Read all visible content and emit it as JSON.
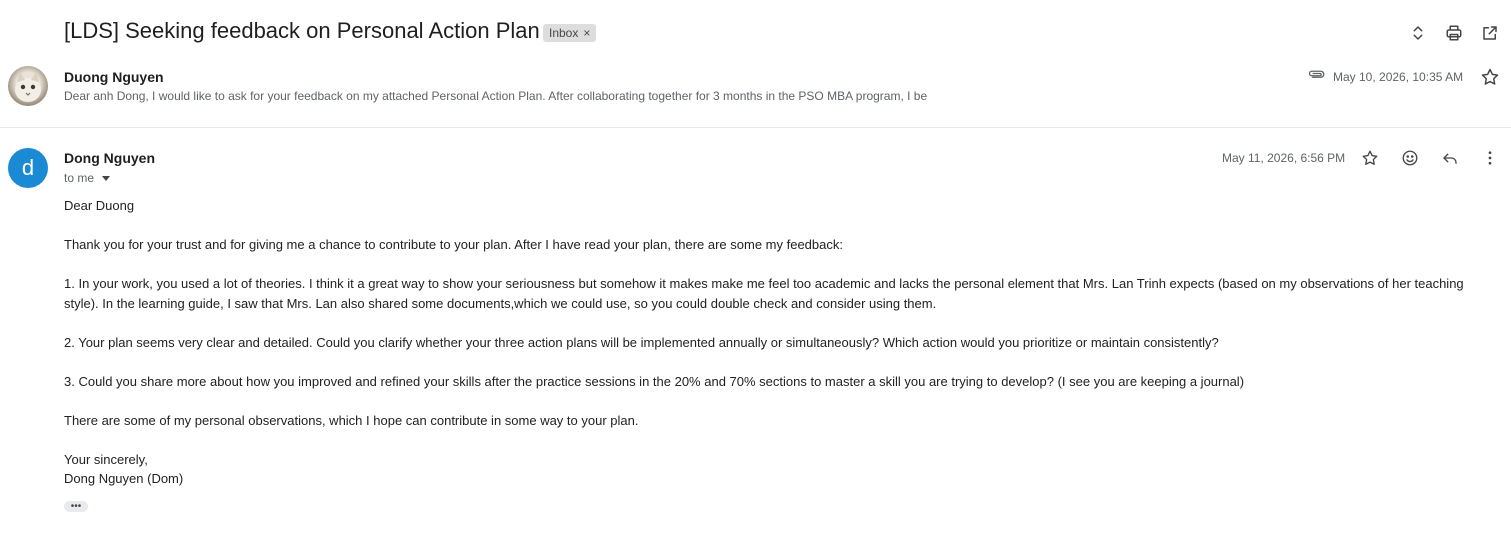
{
  "thread": {
    "subject": "[LDS] Seeking feedback on Personal Action Plan",
    "label": "Inbox",
    "label_remove": "×"
  },
  "toolbar": {
    "icons": [
      "expand-collapse-icon",
      "print-icon",
      "open-in-new-window-icon"
    ]
  },
  "message1": {
    "sender": "Duong Nguyen",
    "snippet": "Dear anh Dong, I would like to ask for your feedback on my attached Personal Action Plan. After collaborating together for 3 months in the PSO MBA program, I be",
    "date": "May 10, 2026, 10:35 AM",
    "has_attachment": true
  },
  "message2": {
    "avatar_letter": "d",
    "avatar_color": "#1a8ad4",
    "sender": "Dong Nguyen",
    "recipient": "to me",
    "date": "May 11, 2026, 6:56 PM",
    "body": {
      "greeting": "Dear Duong",
      "intro": "Thank you for your trust and for giving me a chance to contribute to your plan. After I have read your plan, there are some my feedback:",
      "point1_line1": "1. In your work, you used a lot of theories. I think it a great way to show your seriousness but somehow it makes make me feel too academic and lacks the personal element that Mrs. Lan Trinh expects (based on my observations of her teaching",
      "point1_line2": "style). In the learning guide, I saw that Mrs. Lan also shared some documents,which we could use, so you could double check and consider using them.",
      "point2": "2. Your plan seems very clear and detailed. Could you clarify whether your three action plans will be implemented annually or simultaneously? Which action would you prioritize or maintain consistently?",
      "point3": "3. Could you share more about how you improved and refined your skills after the practice sessions in the 20% and 70% sections to master a skill you are trying to develop? (I see you are keeping a journal)",
      "closing_note": "There are some of my personal observations, which I hope can contribute in some way to your plan.",
      "sign_off": "Your sincerely,",
      "signature": "Dong Nguyen (Dom)"
    },
    "trimmed_content": "•••"
  }
}
